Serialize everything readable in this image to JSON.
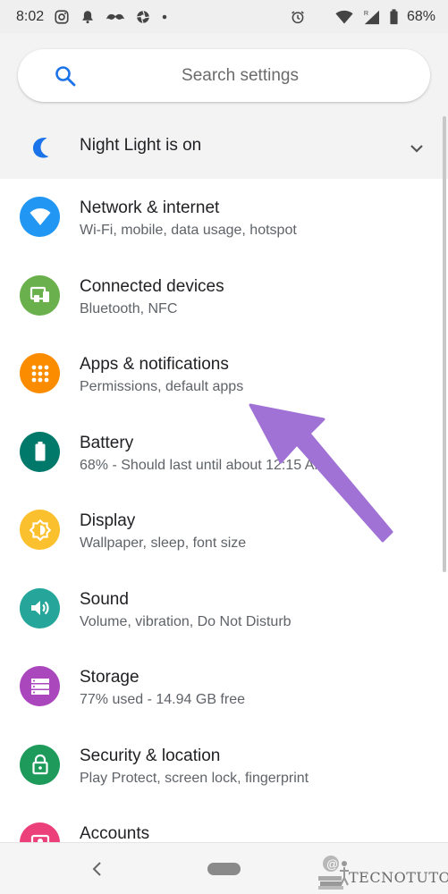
{
  "status_bar": {
    "time": "8:02",
    "battery": "68%",
    "icons_left": [
      "instagram-icon",
      "notification-bell-icon",
      "mustache-icon",
      "aperture-icon",
      "dot-icon"
    ],
    "icons_right": [
      "alarm-icon",
      "wifi-icon",
      "signal-icon",
      "battery-icon"
    ],
    "roaming_indicator": "R"
  },
  "search": {
    "placeholder": "Search settings"
  },
  "night_light": {
    "label": "Night Light is on"
  },
  "settings": [
    {
      "title": "Network & internet",
      "subtitle": "Wi-Fi, mobile, data usage, hotspot",
      "icon": "wifi-icon",
      "color": "#2196f3"
    },
    {
      "title": "Connected devices",
      "subtitle": "Bluetooth, NFC",
      "icon": "devices-icon",
      "color": "#6ab04c"
    },
    {
      "title": "Apps & notifications",
      "subtitle": "Permissions, default apps",
      "icon": "apps-grid-icon",
      "color": "#fb8c00"
    },
    {
      "title": "Battery",
      "subtitle": "68% - Should last until about 12:15 AM",
      "icon": "battery-icon",
      "color": "#00796b"
    },
    {
      "title": "Display",
      "subtitle": "Wallpaper, sleep, font size",
      "icon": "brightness-icon",
      "color": "#fbc02d"
    },
    {
      "title": "Sound",
      "subtitle": "Volume, vibration, Do Not Disturb",
      "icon": "volume-icon",
      "color": "#26a69a"
    },
    {
      "title": "Storage",
      "subtitle": "77% used - 14.94 GB free",
      "icon": "storage-icon",
      "color": "#ab47bc"
    },
    {
      "title": "Security & location",
      "subtitle": "Play Protect, screen lock, fingerprint",
      "icon": "lock-icon",
      "color": "#1e9b5b"
    },
    {
      "title": "Accounts",
      "subtitle": "",
      "icon": "account-icon",
      "color": "#ec407a"
    }
  ],
  "watermark": {
    "text": "TECNOTUTO"
  },
  "annotation": {
    "arrow_color": "#a072d6"
  }
}
